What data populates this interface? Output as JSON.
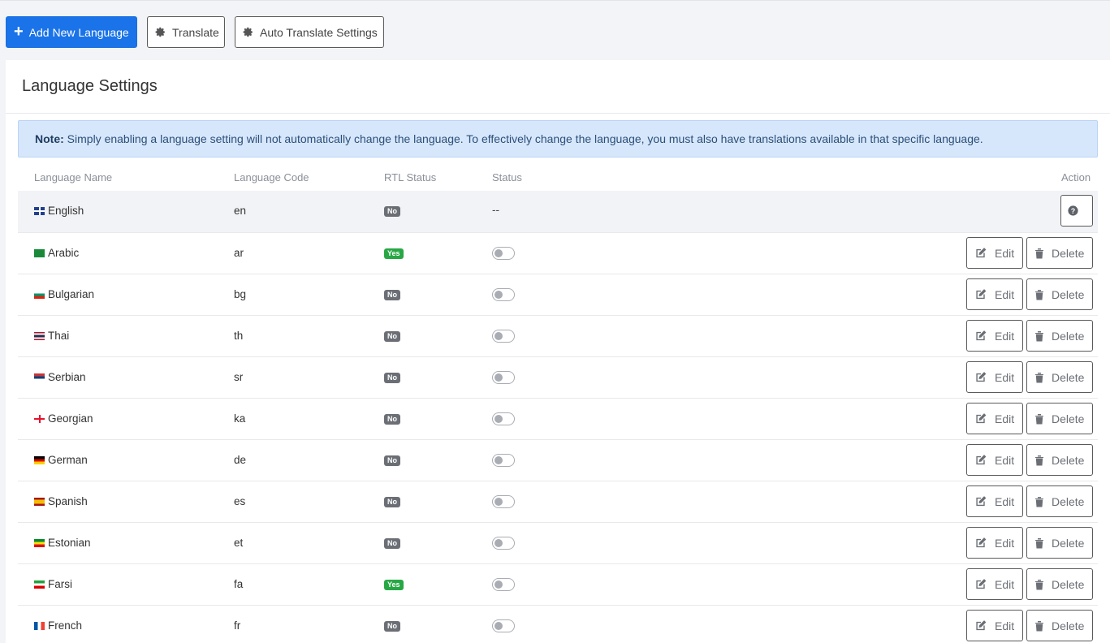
{
  "toolbar": {
    "add_label": "Add New Language",
    "translate_label": "Translate",
    "auto_label": "Auto Translate Settings"
  },
  "card": {
    "title": "Language Settings",
    "note_strong": "Note:",
    "note_text": " Simply enabling a language setting will not automatically change the language. To effectively change the language, you must also have translations available in that specific language."
  },
  "table": {
    "headers": {
      "name": "Language Name",
      "code": "Language Code",
      "rtl": "RTL Status",
      "status": "Status",
      "action": "Action"
    },
    "rows": [
      {
        "name": "English",
        "code": "en",
        "rtl": "No",
        "status": "--",
        "flag": "gb"
      },
      {
        "name": "Arabic",
        "code": "ar",
        "rtl": "Yes",
        "flag": "sa"
      },
      {
        "name": "Bulgarian",
        "code": "bg",
        "rtl": "No",
        "flag": "bg"
      },
      {
        "name": "Thai",
        "code": "th",
        "rtl": "No",
        "flag": "th"
      },
      {
        "name": "Serbian",
        "code": "sr",
        "rtl": "No",
        "flag": "rs"
      },
      {
        "name": "Georgian",
        "code": "ka",
        "rtl": "No",
        "flag": "ge"
      },
      {
        "name": "German",
        "code": "de",
        "rtl": "No",
        "flag": "de"
      },
      {
        "name": "Spanish",
        "code": "es",
        "rtl": "No",
        "flag": "es"
      },
      {
        "name": "Estonian",
        "code": "et",
        "rtl": "No",
        "flag": "et"
      },
      {
        "name": "Farsi",
        "code": "fa",
        "rtl": "Yes",
        "flag": "ir"
      },
      {
        "name": "French",
        "code": "fr",
        "rtl": "No",
        "flag": "fr"
      }
    ],
    "edit_label": "Edit",
    "delete_label": "Delete"
  },
  "colors": {
    "primary": "#1a73e8",
    "note_bg": "#d7e7fb",
    "badge_no": "#6b6f75",
    "badge_yes": "#28a745"
  }
}
